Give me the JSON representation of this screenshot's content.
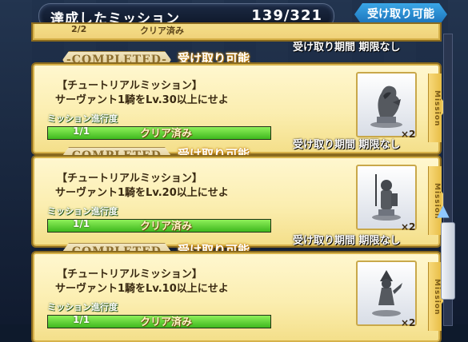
{
  "header": {
    "title": "達成したミッション",
    "count": "139/321",
    "claim_button": "受け取り可能"
  },
  "partial_top": {
    "count": "2/2",
    "status": "クリア済み",
    "period": "受け取り期間 期限なし"
  },
  "missions": [
    {
      "badge": "-COMPLETED-",
      "claimable": "受け取り可能",
      "title": "【チュートリアルミッション】",
      "description": "サーヴァント1騎をLv.30以上にせよ",
      "progress_label": "ミッション進行度",
      "progress_count": "1/1",
      "progress_fraction": 1.0,
      "status": "クリア済み",
      "reward_icon": "dragon-statue-icon",
      "reward_qty": "×2",
      "tab_label": "Mission",
      "period": "受け取り期間 期限なし"
    },
    {
      "badge": "-COMPLETED-",
      "claimable": "受け取り可能",
      "title": "【チュートリアルミッション】",
      "description": "サーヴァント1騎をLv.20以上にせよ",
      "progress_label": "ミッション進行度",
      "progress_count": "1/1",
      "progress_fraction": 1.0,
      "status": "クリア済み",
      "reward_icon": "knight-statue-icon",
      "reward_qty": "×2",
      "tab_label": "Mission",
      "period": "受け取り期間 期限なし"
    },
    {
      "badge": "-COMPLETED-",
      "claimable": "受け取り可能",
      "title": "【チュートリアルミッション】",
      "description": "サーヴァント1騎をLv.10以上にせよ",
      "progress_label": "ミッション進行度",
      "progress_count": "1/1",
      "progress_fraction": 1.0,
      "status": "クリア済み",
      "reward_icon": "warrior-statue-icon",
      "reward_qty": "×2",
      "tab_label": "Mission",
      "period": ""
    }
  ],
  "colors": {
    "card_bg": "#fbeeb0",
    "progress_green": "#3fb81e",
    "header_bg": "#0c1526",
    "accent_blue": "#1a6fb8"
  }
}
